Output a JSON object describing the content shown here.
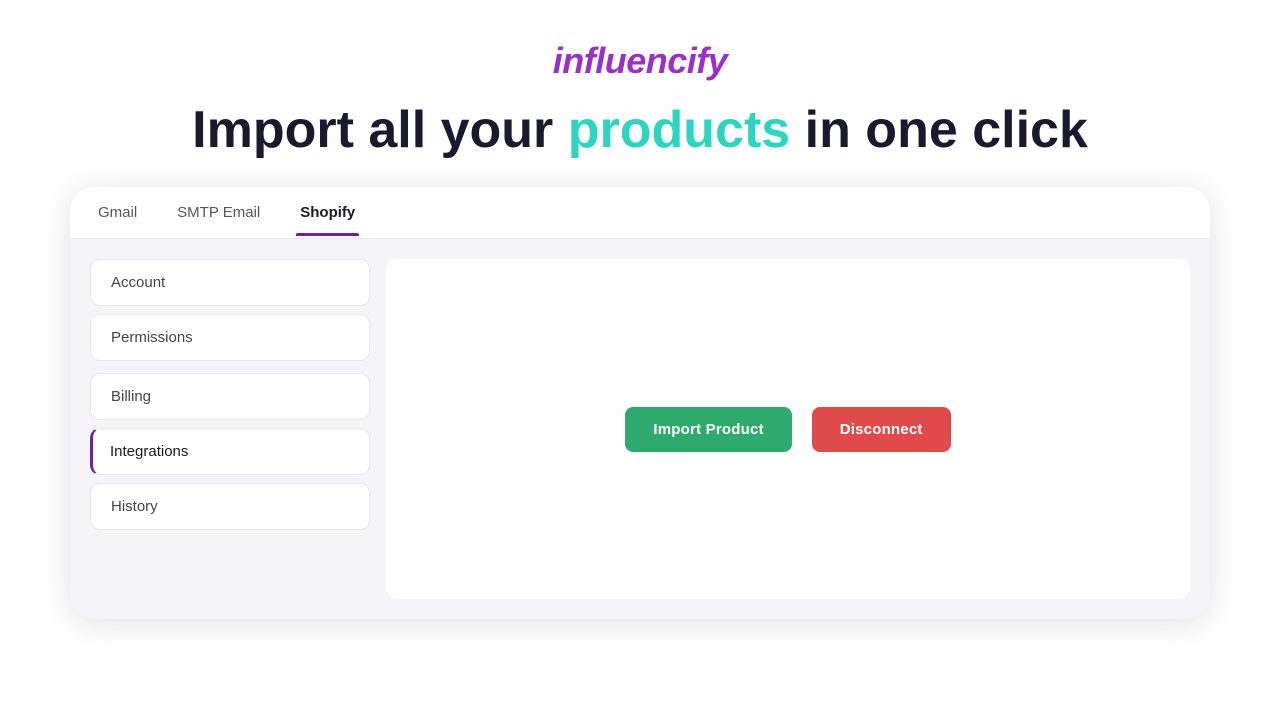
{
  "logo": {
    "text": "influencify"
  },
  "headline": {
    "prefix": "Import all your ",
    "highlight": "products",
    "suffix": " in one click"
  },
  "tabs": [
    {
      "label": "Gmail",
      "active": false
    },
    {
      "label": "SMTP Email",
      "active": false
    },
    {
      "label": "Shopify",
      "active": true
    }
  ],
  "sidebar": {
    "items": [
      {
        "label": "Account",
        "active": false
      },
      {
        "label": "Permissions",
        "active": false
      },
      {
        "label": "Billing",
        "active": false
      },
      {
        "label": "Integrations",
        "active": true
      },
      {
        "label": "History",
        "active": false
      }
    ]
  },
  "actions": {
    "import_label": "Import Product",
    "disconnect_label": "Disconnect"
  }
}
